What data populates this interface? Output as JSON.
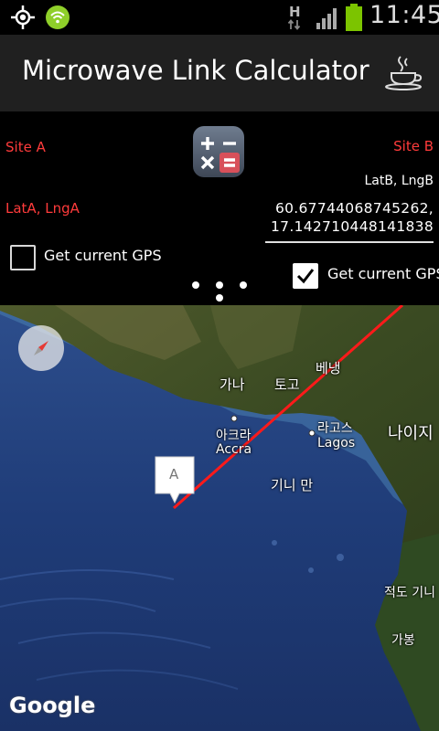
{
  "status_bar": {
    "time": "11:45",
    "network_type": "H",
    "icons": [
      "gps-icon",
      "wifi-icon",
      "net-activity-icon",
      "signal-icon",
      "battery-icon"
    ],
    "battery_color": "#7cc400"
  },
  "action_bar": {
    "title": "Microwave Link Calculator",
    "icon": "coffee-cup-icon"
  },
  "form": {
    "site_a_label": "Site A",
    "site_b_label": "Site B",
    "latlng_a_label": "LatA, LngA",
    "latlng_b_label": "LatB, LngB",
    "latlng_b_value": "60.67744068745262, 17.142710448141838",
    "gps_a": {
      "label": "Get current GPS",
      "checked": false
    },
    "gps_b": {
      "label": "Get current GPS",
      "checked": true
    },
    "accent_color": "#ff3b3b",
    "center_icon": "calculator-icon"
  },
  "pager": {
    "pages": 3,
    "active": 1
  },
  "map": {
    "labels": {
      "ghana": "가나",
      "togo": "토고",
      "benin": "베냉",
      "accra_ko": "아크라",
      "accra_en": "Accra",
      "lagos_ko": "라고스",
      "lagos_en": "Lagos",
      "nigeria": "나이지",
      "gulf_guinea": "기니 만",
      "eq_guinea": "적도 기니",
      "gabon": "가봉"
    },
    "marker_label": "A",
    "logo": "Google",
    "line_color": "#ff1a1a"
  }
}
